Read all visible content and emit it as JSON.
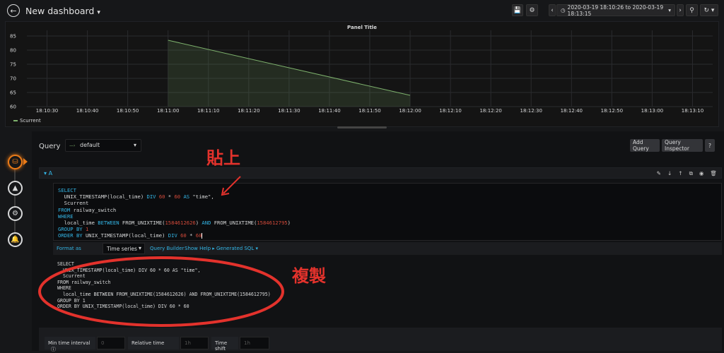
{
  "topbar": {
    "title": "New dashboard",
    "title_caret": "▾",
    "time_range": "2020-03-19 18:10:26 to 2020-03-19 18:13:15",
    "icons": [
      "back-icon",
      "save-icon",
      "gear-icon",
      "clock-icon",
      "chevron-left-icon",
      "chevron-right-icon",
      "zoom-out-icon",
      "refresh-icon"
    ]
  },
  "panel": {
    "title": "Panel Title",
    "legend_series": "Scurrent",
    "series_color": "#7eb26d"
  },
  "chart_data": {
    "type": "area",
    "title": "Panel Title",
    "xlabel": "",
    "ylabel": "",
    "y_ticks": [
      "85",
      "80",
      "75",
      "70",
      "65",
      "60"
    ],
    "x_ticks": [
      "18:10:30",
      "18:10:40",
      "18:10:50",
      "18:11:00",
      "18:11:10",
      "18:11:20",
      "18:11:30",
      "18:11:40",
      "18:11:50",
      "18:12:00",
      "18:12:10",
      "18:12:20",
      "18:12:30",
      "18:12:40",
      "18:12:50",
      "18:13:00",
      "18:13:10"
    ],
    "ylim": [
      60,
      87
    ],
    "series": [
      {
        "name": "Scurrent",
        "x": [
          "18:11:00",
          "18:12:00"
        ],
        "values": [
          83.5,
          64
        ]
      }
    ],
    "legend": "bottom-left",
    "grid": true
  },
  "editor": {
    "query_label": "Query",
    "datasource": "default",
    "add_query": "Add Query",
    "query_inspector": "Query Inspector",
    "help": "?",
    "query_letter": "A",
    "collapse_caret": "▾",
    "format_as_label": "Format as",
    "format_value": "Time series",
    "query_builder": "Query Builder",
    "show_help": "Show Help ▸",
    "generated_sql": "Generated SQL ▾",
    "min_time_interval_label": "Min time interval",
    "min_time_interval_placeholder": "0",
    "relative_time_label": "Relative time",
    "relative_time_placeholder": "1h",
    "time_shift_label": "Time shift",
    "time_shift_placeholder": "1h",
    "info_icon": "ⓘ"
  },
  "sql_lines": [
    "SELECT",
    "  UNIX_TIMESTAMP(local_time) DIV 60 * 60 AS \"time\",",
    "  Scurrent",
    "FROM railway_switch",
    "WHERE",
    "  local_time BETWEEN FROM_UNIXTIME(1584612626) AND FROM_UNIXTIME(1584612795)",
    "GROUP BY 1",
    "ORDER BY UNIX_TIMESTAMP(local_time) DIV 60 * 60"
  ],
  "generated_sql": "SELECT\n  UNIX_TIMESTAMP(local_time) DIV 60 * 60 AS \"time\",\n  Scurrent\nFROM railway_switch\nWHERE\n  local_time BETWEEN FROM_UNIXTIME(1584612626) AND FROM_UNIXTIME(1584612795)\nGROUP BY 1\nORDER BY UNIX_TIMESTAMP(local_time) DIV 60 * 60",
  "annotations": {
    "paste": "貼上",
    "copy": "複製",
    "color": "#e3322c"
  }
}
